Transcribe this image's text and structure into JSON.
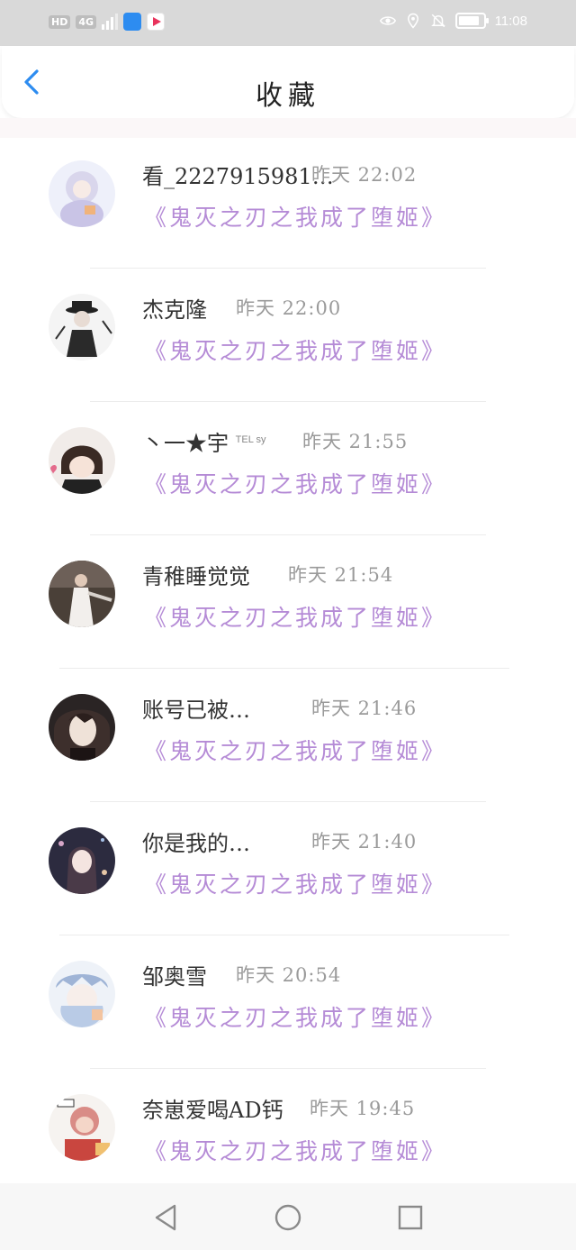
{
  "status_bar": {
    "network_badge": "HD",
    "network_type": "4G",
    "time": "11:08"
  },
  "header": {
    "title": "收藏",
    "back_icon": "chevron-left-icon"
  },
  "items": [
    {
      "name": "看_2227915981…",
      "time": "昨天 22:02",
      "book": "《鬼灭之刃之我成了堕姬》"
    },
    {
      "name": "杰克隆",
      "time": "昨天 22:00",
      "book": "《鬼灭之刃之我成了堕姬》"
    },
    {
      "name": "丶一★宇",
      "name_suffix": "TEL sy",
      "time": "昨天 21:55",
      "book": "《鬼灭之刃之我成了堕姬》"
    },
    {
      "name": "青稚睡觉觉",
      "time": "昨天 21:54",
      "book": "《鬼灭之刃之我成了堕姬》"
    },
    {
      "name": "账号已被…",
      "time": "昨天 21:46",
      "book": "《鬼灭之刃之我成了堕姬》"
    },
    {
      "name": "你是我的…",
      "time": "昨天 21:40",
      "book": "《鬼灭之刃之我成了堕姬》"
    },
    {
      "name": "邹奥雪",
      "time": "昨天 20:54",
      "book": "《鬼灭之刃之我成了堕姬》"
    },
    {
      "name": "奈崽爱喝AD钙",
      "time": "昨天 19:45",
      "book": "《鬼灭之刃之我成了堕姬》"
    }
  ],
  "colors": {
    "accent": "#2d8cf0",
    "book_title": "#b58bd6",
    "time": "#9a9a9a"
  },
  "nav": {
    "back_icon": "triangle-back-icon",
    "home_icon": "circle-home-icon",
    "recent_icon": "square-recent-icon"
  }
}
